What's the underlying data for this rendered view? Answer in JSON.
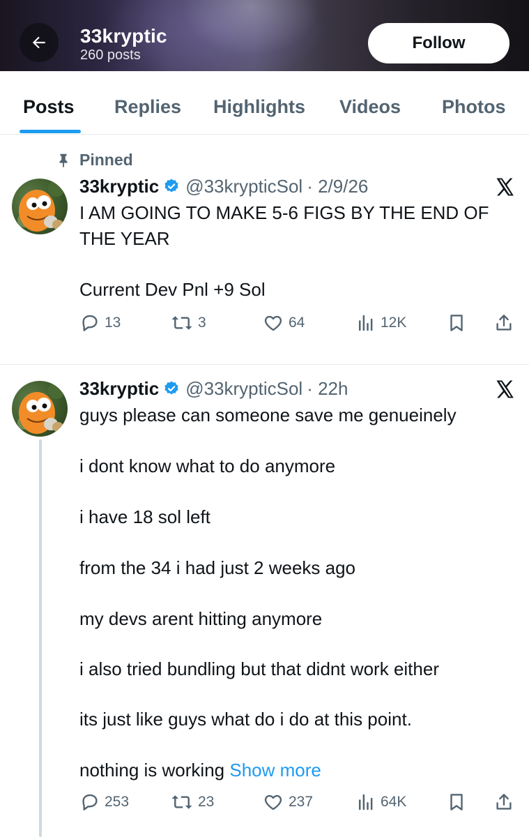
{
  "header": {
    "name": "33kryptic",
    "posts_count": "260 posts",
    "follow_label": "Follow"
  },
  "tabs": [
    {
      "label": "Posts",
      "active": true
    },
    {
      "label": "Replies"
    },
    {
      "label": "Highlights"
    },
    {
      "label": "Videos"
    },
    {
      "label": "Photos"
    }
  ],
  "pinned_label": "Pinned",
  "tweets": [
    {
      "name": "33kryptic",
      "handle": "@33krypticSol",
      "time": "· 2/9/26",
      "lines": [
        "I AM GOING TO MAKE 5-6 FIGS BY THE END OF",
        "THE YEAR",
        "Current Dev Pnl +9 Sol"
      ],
      "replies": "13",
      "reposts": "3",
      "likes": "64",
      "views": "12K"
    },
    {
      "name": "33kryptic",
      "handle": "@33krypticSol",
      "time": "· 22h",
      "lines": [
        "guys please can someone save me genueinely",
        "i dont know what to do anymore",
        "i have 18 sol left",
        "from the 34 i had just 2 weeks ago",
        "my devs arent hitting anymore",
        "i also tried bundling but that didnt work either",
        "its just like guys what do i do at this point.",
        "nothing is working"
      ],
      "show_more": "Show more",
      "replies": "253",
      "reposts": "23",
      "likes": "237",
      "views": "64K"
    }
  ],
  "icons": {
    "back": "arrow-left-icon",
    "pin": "pin-icon",
    "verified": "verified-badge-icon",
    "x": "x-logo-icon",
    "reply": "reply-icon",
    "repost": "repost-icon",
    "like": "heart-icon",
    "views": "views-icon",
    "bookmark": "bookmark-icon",
    "share": "share-icon"
  },
  "colors": {
    "accent": "#1d9bf0",
    "text": "#0f1419",
    "secondary": "#536471",
    "divider": "#e6e9ec",
    "avatar_orange": "#f28c28"
  }
}
